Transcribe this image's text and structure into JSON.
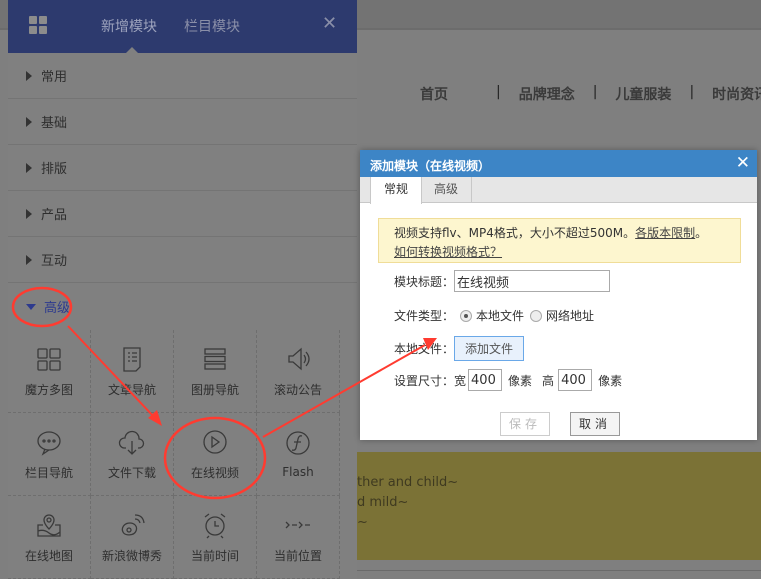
{
  "page": {
    "nav": [
      "首页",
      "品牌理念",
      "儿童服装",
      "时尚资讯"
    ],
    "content_lines": [
      "ther and child~",
      "d mild~",
      "~"
    ]
  },
  "panel": {
    "tabs": [
      "新增模块",
      "栏目模块"
    ],
    "categories": [
      "常用",
      "基础",
      "排版",
      "产品",
      "互动",
      "高级"
    ],
    "modules": [
      {
        "label": "魔方多图",
        "icon": "grid-blocks-icon"
      },
      {
        "label": "文章导航",
        "icon": "document-list-icon"
      },
      {
        "label": "图册导航",
        "icon": "stack-icon"
      },
      {
        "label": "滚动公告",
        "icon": "speaker-icon"
      },
      {
        "label": "栏目导航",
        "icon": "chat-bubble-icon"
      },
      {
        "label": "文件下载",
        "icon": "cloud-download-icon"
      },
      {
        "label": "在线视频",
        "icon": "play-circle-icon"
      },
      {
        "label": "Flash",
        "icon": "flash-icon"
      },
      {
        "label": "在线地图",
        "icon": "map-pin-icon"
      },
      {
        "label": "新浪微博秀",
        "icon": "weibo-icon"
      },
      {
        "label": "当前时间",
        "icon": "alarm-clock-icon"
      },
      {
        "label": "当前位置",
        "icon": "breadcrumb-arrows-icon"
      }
    ]
  },
  "dialog": {
    "title": "添加模块（在线视频）",
    "tabs": [
      "常规",
      "高级"
    ],
    "notice": {
      "text": "视频支持flv、MP4格式，大小不超过500M。",
      "link1": "各版本限制",
      "after": "。",
      "link2": "如何转换视频格式？"
    },
    "title_label": "模块标题：",
    "title_value": "在线视频",
    "type_label": "文件类型：",
    "type_options": [
      "本地文件",
      "网络地址"
    ],
    "type_selected": "本地文件",
    "local_label": "本地文件：",
    "add_file": "添加文件",
    "size_label": "设置尺寸：",
    "width_label": "宽",
    "width_value": "400",
    "height_label": "高",
    "height_value": "400",
    "unit": "像素",
    "save": "保存",
    "cancel": "取消"
  },
  "colors": {
    "panel_header": "#2d3a6e",
    "dialog_header": "#3d85c6",
    "annotation": "#ff3b30"
  }
}
